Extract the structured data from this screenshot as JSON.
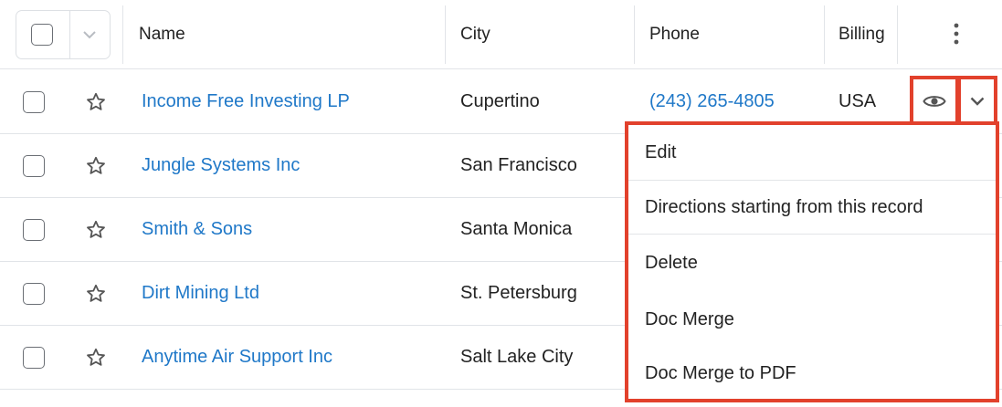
{
  "columns": {
    "name": "Name",
    "city": "City",
    "phone": "Phone",
    "billing": "Billing"
  },
  "rows": [
    {
      "name": "Income Free Investing LP",
      "city": "Cupertino",
      "phone": "(243) 265-4805",
      "billing": "USA"
    },
    {
      "name": "Jungle Systems Inc",
      "city": "San Francisco",
      "phone": "",
      "billing": ""
    },
    {
      "name": "Smith & Sons",
      "city": "Santa Monica",
      "phone": "",
      "billing": ""
    },
    {
      "name": "Dirt Mining Ltd",
      "city": "St. Petersburg",
      "phone": "",
      "billing": ""
    },
    {
      "name": "Anytime Air Support Inc",
      "city": "Salt Lake City",
      "phone": "",
      "billing": ""
    }
  ],
  "actions_menu": {
    "items": [
      "Edit",
      "Directions starting from this record",
      "Delete",
      "Doc Merge",
      "Doc Merge to PDF"
    ]
  },
  "colors": {
    "link": "#1f78c8",
    "highlight": "#e2412c",
    "border": "#e1e4e8"
  },
  "icons": {
    "bulk_checkbox": "checkbox-icon",
    "bulk_caret": "chevron-down-icon",
    "column_menu": "kebab-icon",
    "favorite": "star-icon",
    "preview": "eye-icon",
    "actions": "chevron-down-icon"
  }
}
